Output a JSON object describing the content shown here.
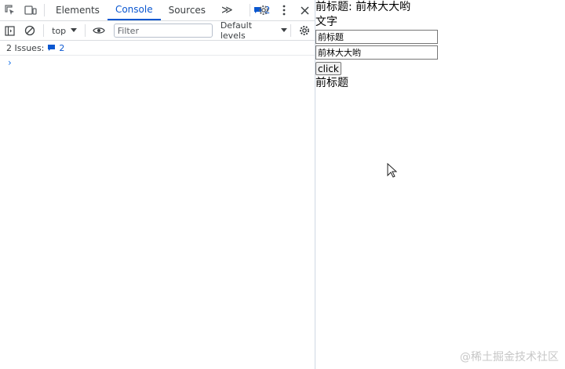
{
  "devtools": {
    "tabs": [
      {
        "label": "Elements"
      },
      {
        "label": "Console"
      },
      {
        "label": "Sources"
      }
    ],
    "more_tabs_glyph": "≫",
    "issues_count": "2",
    "toolbar": {
      "context": "top",
      "filter_placeholder": "Filter",
      "levels": "Default levels"
    },
    "issues_row": {
      "label": "2 Issues:",
      "count": "2"
    },
    "prompt_glyph": "›"
  },
  "page": {
    "heading": "前标题: 前林大大哟",
    "text_label": "文字",
    "input1_value": "前标题",
    "input2_value": "前林大大哟",
    "button_label": "click",
    "result": "前标题"
  },
  "watermark": "@稀土掘金技术社区",
  "colors": {
    "accent": "#0b57d0",
    "border": "#dadce0"
  }
}
